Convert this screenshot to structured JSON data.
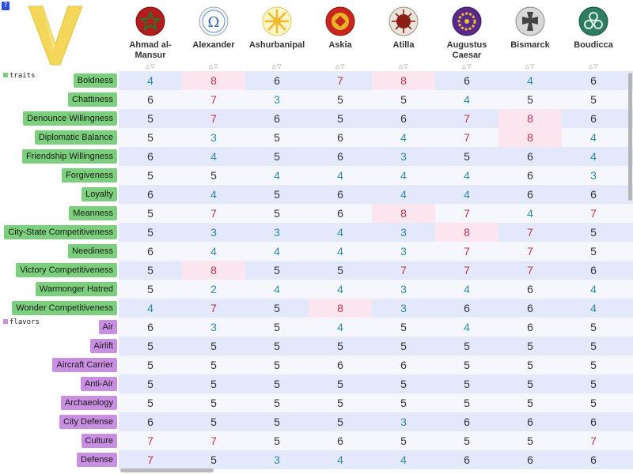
{
  "app": {
    "help_label": "?"
  },
  "colors": {
    "traits": "#7ccf7c",
    "flavors": "#c98fe2",
    "low": "#2a8aa6",
    "mid": "#333333",
    "high": "#c0314a"
  },
  "leaders": [
    {
      "name": "Ahmad al-\nMansur",
      "icon": "morocco-star-emblem"
    },
    {
      "name": "Alexander",
      "icon": "greek-omega-emblem"
    },
    {
      "name": "Ashurbanipal",
      "icon": "assyria-sun-emblem"
    },
    {
      "name": "Askia",
      "icon": "songhai-emblem"
    },
    {
      "name": "Atilla",
      "icon": "huns-emblem"
    },
    {
      "name": "Augustus\nCaesar",
      "icon": "rome-wreath-emblem"
    },
    {
      "name": "Bismarck",
      "icon": "german-cross-emblem"
    },
    {
      "name": "Boudicca",
      "icon": "celtic-knot-emblem"
    }
  ],
  "sort_glyphs": "△▽",
  "sections": [
    {
      "label": "traits",
      "kind": "traits",
      "rows": [
        {
          "label": "Boldness",
          "values": [
            4,
            8,
            6,
            7,
            8,
            6,
            4,
            6
          ]
        },
        {
          "label": "Chattiness",
          "values": [
            6,
            7,
            3,
            5,
            5,
            4,
            5,
            5
          ]
        },
        {
          "label": "Denounce Willingness",
          "values": [
            5,
            7,
            6,
            5,
            6,
            7,
            8,
            6
          ]
        },
        {
          "label": "Diplomatic Balance",
          "values": [
            5,
            3,
            5,
            6,
            4,
            7,
            8,
            4
          ]
        },
        {
          "label": "Friendship Willingness",
          "values": [
            6,
            4,
            5,
            6,
            3,
            5,
            6,
            4
          ]
        },
        {
          "label": "Forgiveness",
          "values": [
            5,
            5,
            4,
            4,
            4,
            4,
            6,
            3
          ]
        },
        {
          "label": "Loyalty",
          "values": [
            6,
            4,
            5,
            6,
            4,
            4,
            6,
            6
          ]
        },
        {
          "label": "Meanness",
          "values": [
            5,
            7,
            5,
            6,
            8,
            7,
            4,
            7
          ]
        },
        {
          "label": "City-State Competitiveness",
          "values": [
            5,
            3,
            3,
            4,
            3,
            8,
            7,
            5
          ]
        },
        {
          "label": "Neediness",
          "values": [
            6,
            4,
            4,
            4,
            3,
            7,
            7,
            5
          ]
        },
        {
          "label": "Victory Competitiveness",
          "values": [
            5,
            8,
            5,
            5,
            7,
            7,
            7,
            6
          ]
        },
        {
          "label": "Warmonger Hatred",
          "values": [
            5,
            2,
            4,
            4,
            3,
            4,
            6,
            4
          ]
        },
        {
          "label": "Wonder Competitiveness",
          "values": [
            4,
            7,
            5,
            8,
            3,
            6,
            6,
            4
          ]
        }
      ]
    },
    {
      "label": "flavors",
      "kind": "flavors",
      "rows": [
        {
          "label": "Air",
          "values": [
            6,
            3,
            5,
            4,
            5,
            4,
            6,
            5
          ]
        },
        {
          "label": "Airlift",
          "values": [
            5,
            5,
            5,
            5,
            5,
            5,
            5,
            5
          ]
        },
        {
          "label": "Aircraft Carrier",
          "values": [
            5,
            5,
            5,
            6,
            6,
            5,
            5,
            5
          ]
        },
        {
          "label": "Anti-Air",
          "values": [
            5,
            5,
            5,
            5,
            5,
            5,
            5,
            5
          ]
        },
        {
          "label": "Archaeology",
          "values": [
            5,
            5,
            5,
            5,
            5,
            5,
            5,
            5
          ]
        },
        {
          "label": "City Defense",
          "values": [
            6,
            5,
            5,
            5,
            3,
            6,
            6,
            6
          ]
        },
        {
          "label": "Culture",
          "values": [
            7,
            7,
            5,
            6,
            5,
            5,
            5,
            7
          ]
        },
        {
          "label": "Defense",
          "values": [
            7,
            5,
            3,
            4,
            4,
            6,
            6,
            6
          ]
        }
      ]
    }
  ]
}
